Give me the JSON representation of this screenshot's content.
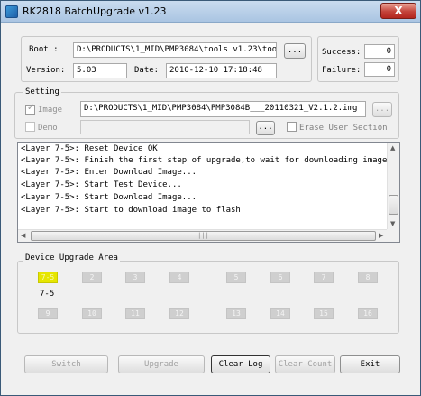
{
  "window": {
    "title": "RK2818 BatchUpgrade v1.23",
    "close_label": "X"
  },
  "info": {
    "boot_label": "Boot :",
    "boot_value": "D:\\PRODUCTS\\1_MID\\PMP3084\\tools v1.23\\tools",
    "browse_label": "...",
    "version_label": "Version:",
    "version_value": "5.03",
    "date_label": "Date:",
    "date_value": "2010-12-10 17:18:48",
    "success_label": "Success:",
    "success_value": "0",
    "failure_label": "Failure:",
    "failure_value": "0"
  },
  "setting": {
    "section_label": "Setting",
    "image_label": "Image",
    "image_checked": true,
    "image_path": "D:\\PRODUCTS\\1_MID\\PMP3084\\PMP3084B___20110321_V2.1.2.img",
    "image_browse": "...",
    "demo_label": "Demo",
    "demo_checked": false,
    "demo_path": "",
    "demo_browse": "...",
    "erase_label": "Erase User Section",
    "erase_checked": false
  },
  "log": {
    "lines": [
      "<Layer 7-5>: Reset Device OK",
      "<Layer 7-5>: Finish the first step of upgrade,to wait for downloading image...",
      "<Layer 7-5>: Enter Download Image...",
      "<Layer 7-5>: Start Test Device...",
      "<Layer 7-5>: Start Download Image...",
      "<Layer 7-5>: Start to download image to flash"
    ],
    "scroll_up": "▲",
    "scroll_down": "▼",
    "scroll_left": "◀",
    "scroll_right": "▶",
    "thumb_grip": "|||"
  },
  "devices": {
    "section_label": "Device Upgrade Area",
    "row1": [
      "7-5",
      "2",
      "3",
      "4",
      "5",
      "6",
      "7",
      "8"
    ],
    "row2": [
      "9",
      "10",
      "11",
      "12",
      "13",
      "14",
      "15",
      "16"
    ],
    "active_index": 0,
    "active_caption": "7-5",
    "active_color": "#e6e600",
    "idle_color": "#cfcfcf"
  },
  "buttons": {
    "switch": "Switch",
    "upgrade": "Upgrade",
    "clear_log": "Clear Log",
    "clear_count": "Clear Count",
    "exit": "Exit"
  }
}
